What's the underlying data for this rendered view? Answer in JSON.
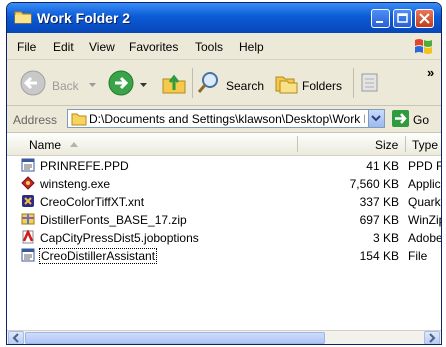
{
  "window": {
    "title": "Work Folder 2"
  },
  "menu": {
    "items": [
      "File",
      "Edit",
      "View",
      "Favorites",
      "Tools",
      "Help"
    ]
  },
  "toolbar": {
    "back_label": "Back",
    "search_label": "Search",
    "folders_label": "Folders",
    "more": "»"
  },
  "address": {
    "label": "Address",
    "path": "D:\\Documents and Settings\\klawson\\Desktop\\Work F",
    "go_label": "Go"
  },
  "columns": {
    "name": "Name",
    "size": "Size",
    "type": "Type"
  },
  "files": [
    {
      "name": "PRINREFE.PPD",
      "size": "41 KB",
      "type": "PPD Fil",
      "icon": "ppd-file-icon"
    },
    {
      "name": "winsteng.exe",
      "size": "7,560 KB",
      "type": "Applica",
      "icon": "exe-file-icon"
    },
    {
      "name": "CreoColorTiffXT.xnt",
      "size": "337 KB",
      "type": "QuarkX",
      "icon": "xtension-file-icon"
    },
    {
      "name": "DistillerFonts_BASE_17.zip",
      "size": "697 KB",
      "type": "WinZip",
      "icon": "zip-file-icon"
    },
    {
      "name": "CapCityPressDist5.joboptions",
      "size": "3 KB",
      "type": "Adobe",
      "icon": "joboptions-file-icon"
    },
    {
      "name": "CreoDistillerAssistant",
      "size": "154 KB",
      "type": "File",
      "icon": "generic-file-icon"
    }
  ],
  "colors": {
    "titlebar": "#0a5bd6",
    "selection_border": "#000000",
    "window_bg": "#ece9d8"
  }
}
